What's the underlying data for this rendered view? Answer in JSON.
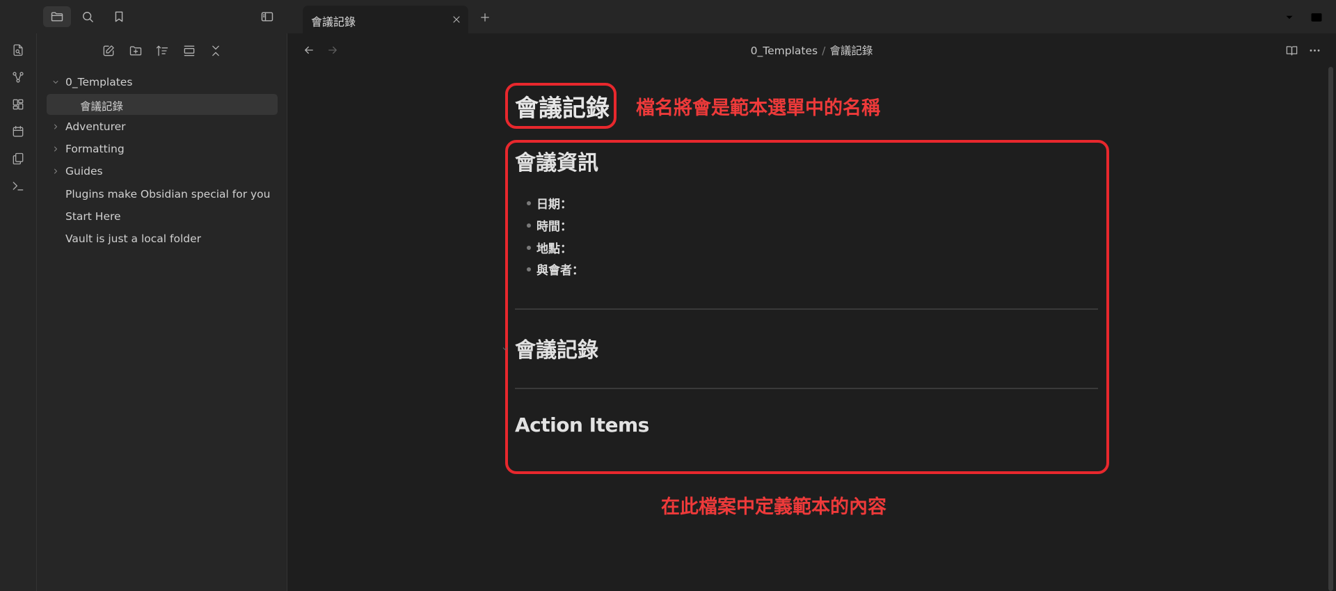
{
  "tab": {
    "title": "會議記錄"
  },
  "sidebar": {
    "tree": [
      {
        "label": "0_Templates",
        "type": "folder",
        "expanded": true
      },
      {
        "label": "會議記錄",
        "type": "file",
        "selected": true
      },
      {
        "label": "Adventurer",
        "type": "folder",
        "expanded": false
      },
      {
        "label": "Formatting",
        "type": "folder",
        "expanded": false
      },
      {
        "label": "Guides",
        "type": "folder",
        "expanded": false
      },
      {
        "label": "Plugins make Obsidian special for you",
        "type": "file"
      },
      {
        "label": "Start Here",
        "type": "file"
      },
      {
        "label": "Vault is just a local folder",
        "type": "file"
      }
    ]
  },
  "breadcrumb": {
    "folder": "0_Templates",
    "separator": "/",
    "file": "會議記錄"
  },
  "document": {
    "title": "會議記錄",
    "sections": [
      {
        "heading": "會議資訊",
        "items": [
          "日期：",
          "時間：",
          "地點：",
          "與會者："
        ]
      },
      {
        "heading": "會議記錄"
      },
      {
        "heading": "Action Items"
      }
    ]
  },
  "annotations": {
    "title_note": "檔名將會是範本選單中的名稱",
    "body_note": "在此檔案中定義範本的內容",
    "color": "#e8282d"
  },
  "icons": {
    "top": [
      "folder-icon",
      "search-icon",
      "bookmark-icon",
      "sidebar-toggle-icon",
      "close-icon",
      "plus-icon",
      "chevron-down-icon",
      "right-sidebar-icon"
    ],
    "ribbon": [
      "open-quick-switcher-icon",
      "graph-view-icon",
      "canvas-icon",
      "daily-note-icon",
      "templates-icon",
      "command-palette-icon"
    ],
    "sidebar_toolbar": [
      "new-note-icon",
      "new-folder-icon",
      "sort-icon",
      "auto-reveal-icon",
      "collapse-all-icon"
    ],
    "view": [
      "back-arrow-icon",
      "forward-arrow-icon",
      "reading-view-icon",
      "more-options-icon"
    ]
  }
}
